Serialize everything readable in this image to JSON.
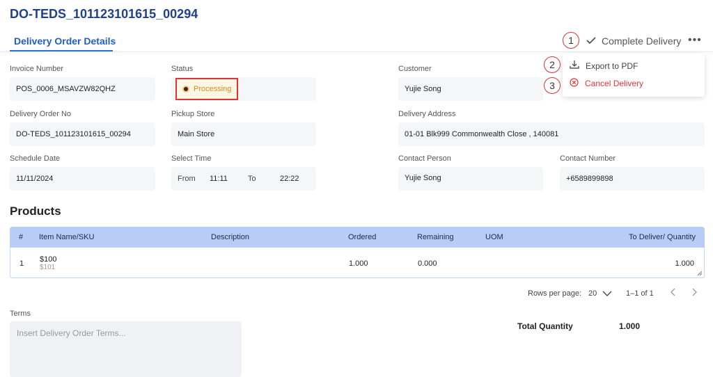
{
  "page": {
    "title": "DO-TEDS_101123101615_00294",
    "tab": "Delivery Order Details"
  },
  "actions": {
    "complete_label": "Complete Delivery",
    "more_label": "•••",
    "menu": {
      "export_label": "Export to PDF",
      "cancel_label": "Cancel Delivery"
    },
    "annotations": [
      "1",
      "2",
      "3"
    ]
  },
  "fields": {
    "invoice_number": {
      "label": "Invoice Number",
      "value": "POS_0006_MSAVZW82QHZ"
    },
    "status": {
      "label": "Status",
      "value": "Processing"
    },
    "customer": {
      "label": "Customer",
      "value": "Yujie Song"
    },
    "delivery_order_no": {
      "label": "Delivery Order No",
      "value": "DO-TEDS_101123101615_00294"
    },
    "pickup_store": {
      "label": "Pickup Store",
      "value": "Main Store"
    },
    "delivery_address": {
      "label": "Delivery Address",
      "value": "01-01 Blk999 Commonwealth Close , 140081"
    },
    "schedule_date": {
      "label": "Schedule Date",
      "value": "11/11/2024"
    },
    "select_time": {
      "label": "Select Time",
      "from_label": "From",
      "from_value": "11:11",
      "to_label": "To",
      "to_value": "22:22"
    },
    "contact_person": {
      "label": "Contact Person",
      "value": "Yujie Song"
    },
    "contact_number": {
      "label": "Contact Number",
      "value": "+6589899898"
    }
  },
  "products": {
    "title": "Products",
    "headers": {
      "index": "#",
      "item": "Item Name/SKU",
      "description": "Description",
      "ordered": "Ordered",
      "remaining": "Remaining",
      "uom": "UOM",
      "to_deliver": "To Deliver/ Quantity"
    },
    "rows": [
      {
        "index": "1",
        "item": "$100",
        "sku": "$101",
        "description": "",
        "ordered": "1.000",
        "remaining": "0.000",
        "uom": "",
        "to_deliver": "1.000"
      }
    ]
  },
  "pagination": {
    "rows_per_page_label": "Rows per page:",
    "rows_per_page": "20",
    "range": "1–1 of 1"
  },
  "terms": {
    "label": "Terms",
    "placeholder": "Insert Delivery Order Terms..."
  },
  "totals": {
    "label": "Total Quantity",
    "value": "1.000"
  },
  "colors": {
    "accent": "#2f6fd1",
    "danger": "#e03535",
    "status_processing": "#d88b1a"
  }
}
